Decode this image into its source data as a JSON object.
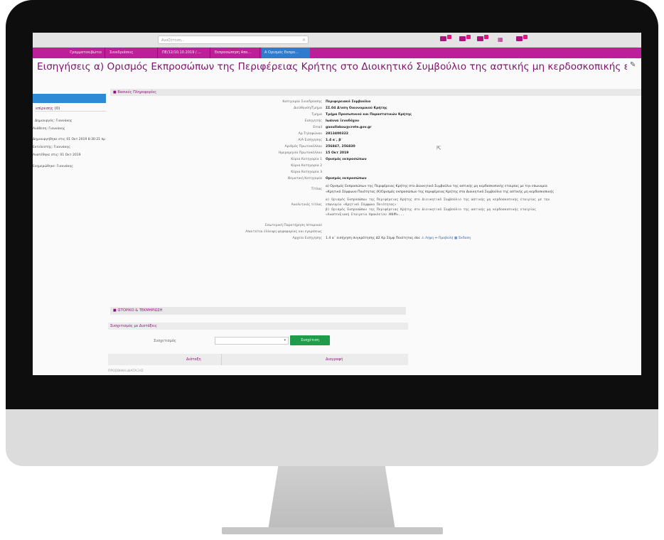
{
  "topbar": {
    "search_placeholder": "Αναζήτηση..."
  },
  "tabs": [
    {
      "label": "Γραμματοκιβώτιο"
    },
    {
      "label": "Συνεδριάσεις"
    },
    {
      "label": "ΠΕ/12/10.10.2019 / ..."
    },
    {
      "label": "Εκπροσώπηση Απο..."
    },
    {
      "label": "Α Ορισμός Εκπρο...",
      "active": true
    }
  ],
  "page": {
    "title": "Εισηγήσεις α) Ορισμός Εκπροσώπων της Περιφέρειας Κρήτης στο Διοικητικό Συμβούλιο της αστικής μη κερδοσκοπικής εταιρίας με την επωνυ..."
  },
  "sidebar": {
    "link": "επίρεσης (0)",
    "lines": [
      "Δημιουργός: Γιαννάκης",
      "Ανάθεση: Γιαννάκης",
      "Δημιουργήθηκε στις 01 Οκτ 2019 8:30:21 πμ",
      "Εκτελεστής: Γιαννάκης",
      "Ανατέθηκε στις: 01 Οκτ 2019",
      "Ενημερώθηκε: Γιαννάκης"
    ]
  },
  "panel": {
    "header": "■ Βασικές Πληροφορίες",
    "rows": [
      {
        "label": "Κατηγορία Συνεδρίασης",
        "value": "Περιφερειακό Συμβούλιο"
      },
      {
        "label": "Διεύθυνση/Τμήμα",
        "value": "ΣΣ.04 Δ/νση Οικονομικού Κρήτης"
      },
      {
        "label": "Τμήμα",
        "value": "Τμήμα Προσωπικού και Παραστατικών Κρήτης"
      },
      {
        "label": "Εισηγητής",
        "value": "Ιωάννα Ξενοδόχου"
      },
      {
        "label": "Email",
        "value": "gaoullakou@crete.gov.gr"
      },
      {
        "label": "Αρ.Τηλεφώνου",
        "value": "2813400322"
      },
      {
        "label": "Α/Α Εισήγησης",
        "value": "1.4 α΄, β΄"
      },
      {
        "label": "Αριθμός Πρωτοκόλλου",
        "value": "256847, 256830"
      },
      {
        "label": "Ημερομηνία Πρωτοκόλλου",
        "value": "15 Οκτ 2019"
      },
      {
        "label": "Κύρια Κατηγορία 1",
        "value": "Ορισμός εκπροσώπων"
      },
      {
        "label": "Κύρια Κατηγορία 2",
        "value": ""
      },
      {
        "label": "Κύρια Κατηγορία 3",
        "value": ""
      },
      {
        "label": "Θεματική Κατηγορία",
        "value": "Ορισμός εκπροσώπων"
      },
      {
        "label": "Τίτλος",
        "value": "α) Ορισμός Εκπροσώπων της Περιφέρειας Κρήτης στο Διοικητικό Συμβούλιο της αστικής μη κερδοσκοπικής εταιρίας με την επωνυμία"
      },
      {
        "label": "",
        "value": "«Κρητικό Σύμφωνο Ποιότητας (Κ)Ορισμός εκπροσώπων της περιφέρειας Κρήτης στο Διοικητικό Συμβούλιο της αστικής μη κερδοσκοπικής"
      },
      {
        "label": "",
        "value": "α) Ορισμός Εκπροσώπων της Περιφέρειας Κρήτης στο Διοικητικό Συμβούλιο της αστικής μη κερδοσκοπικής εταιρίας με την"
      },
      {
        "label": "Αναλυτικός τίτλος",
        "value": "επωνυμία «Κρητικό Σύμφωνο Ποιότητας»"
      },
      {
        "label": "",
        "value": "β) Ορισμός Εκπροσώπων της Περιφέρειας Κρήτης στο Διοικητικό Συμβούλιο της αστικής μη κερδοσκοπικής εταιρίας"
      },
      {
        "label": "",
        "value": "«Αναπτυξιακή Εταιρεία Ηρακλείου ΑΝΗΜ»..."
      },
      {
        "label": "Εσωτερική Παρατήρηση Ιστορικού",
        "value": ""
      },
      {
        "label": "Απαιτείται έλλειψη ψηφοφορίας και εγκρίσεως",
        "value": ""
      },
      {
        "label": "Αρχεία Εισήγησης",
        "value": "1.4 α΄ εισήγηση συγκρότησης ΔΣ Κρ Σύμφ Ποιότητας.doc",
        "extra": "⚠ Λήψη ⇔ Προβολή ▦ Έκδοση"
      }
    ]
  },
  "history": {
    "header": "■ ΙΣΤΟΡΙΚΟ & ΤΕΚΜΗΡΙΩΣΗ",
    "assoc_header": "Συσχετισμός με Διατάξεις",
    "assoc_label": "Συσχετισμός",
    "assoc_button": "Συσχέτιση",
    "col1": "Διάταξη",
    "col2": "Διαγραφή",
    "subtext": "ΠΡΟΣΘΗΚΗ ΔΙΑΤΑΞΗΣ"
  }
}
